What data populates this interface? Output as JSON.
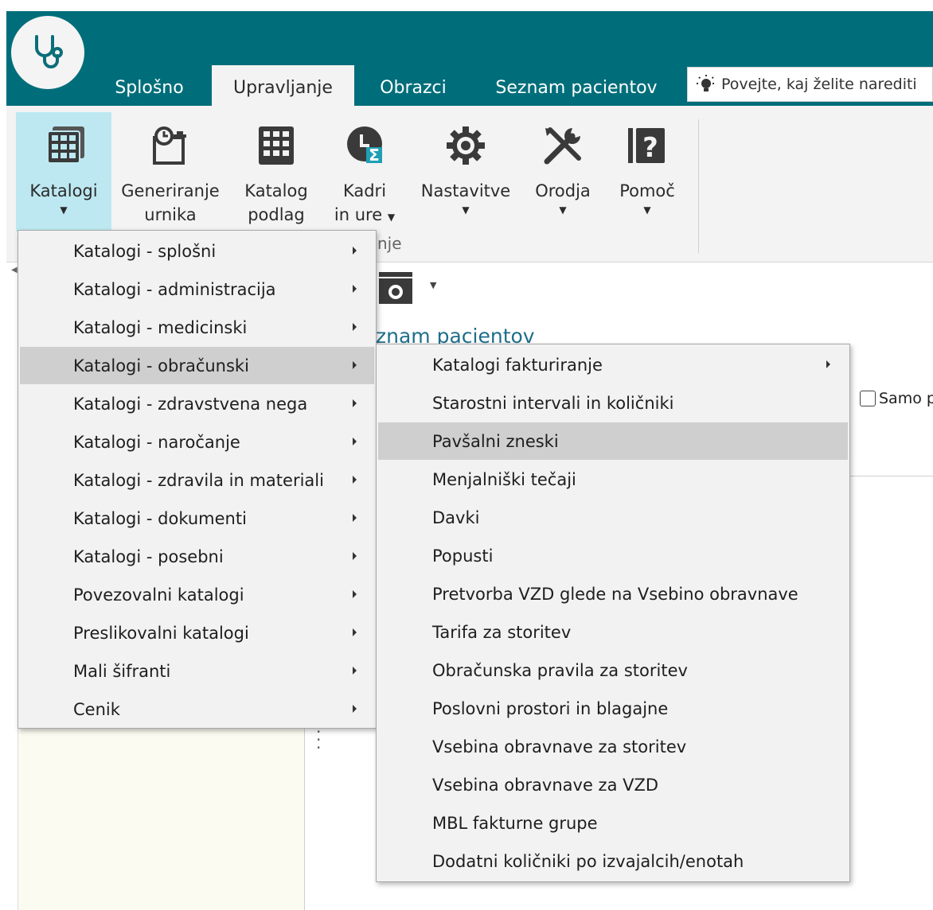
{
  "tabs": [
    {
      "label": "Splošno",
      "active": false
    },
    {
      "label": "Upravljanje",
      "active": true
    },
    {
      "label": "Obrazci",
      "active": false
    },
    {
      "label": "Seznam pacientov",
      "active": false
    }
  ],
  "tell_me": {
    "text": "Povejte, kaj želite narediti"
  },
  "ribbon": {
    "buttons": [
      {
        "line1": "Katalogi",
        "line2": "",
        "icon": "catalog-grid-icon",
        "dropdown": true,
        "active": true
      },
      {
        "line1": "Generiranje",
        "line2": "urnika",
        "icon": "schedule-clock-icon",
        "dropdown": false
      },
      {
        "line1": "Katalog",
        "line2": "podlag",
        "icon": "grid-keypad-icon",
        "dropdown": false
      },
      {
        "line1": "Kadri",
        "line2": "in ure",
        "icon": "staff-sum-icon",
        "dropdown": true
      },
      {
        "line1": "Nastavitve",
        "line2": "",
        "icon": "gear-icon",
        "dropdown": true
      },
      {
        "line1": "Orodja",
        "line2": "",
        "icon": "tools-icon",
        "dropdown": true
      },
      {
        "line1": "Pomoč",
        "line2": "",
        "icon": "help-icon",
        "dropdown": true
      }
    ],
    "group_label": "nje"
  },
  "background": {
    "title": "znam pacientov",
    "checkbox_label": "Samo p"
  },
  "main_menu": {
    "items": [
      {
        "label": "Katalogi - splošni",
        "highlighted": false
      },
      {
        "label": "Katalogi - administracija",
        "highlighted": false
      },
      {
        "label": "Katalogi - medicinski",
        "highlighted": false
      },
      {
        "label": "Katalogi - obračunski",
        "highlighted": true
      },
      {
        "label": "Katalogi - zdravstvena nega",
        "highlighted": false
      },
      {
        "label": "Katalogi - naročanje",
        "highlighted": false
      },
      {
        "label": "Katalogi - zdravila in materiali",
        "highlighted": false
      },
      {
        "label": "Katalogi - dokumenti",
        "highlighted": false
      },
      {
        "label": "Katalogi - posebni",
        "highlighted": false
      },
      {
        "label": "Povezovalni katalogi",
        "highlighted": false
      },
      {
        "label": "Preslikovalni katalogi",
        "highlighted": false
      },
      {
        "label": "Mali šifranti",
        "highlighted": false
      },
      {
        "label": "Cenik",
        "highlighted": false
      }
    ]
  },
  "sub_menu": {
    "items": [
      {
        "label": "Katalogi fakturiranje",
        "highlighted": false,
        "has_sub": true
      },
      {
        "label": "Starostni intervali in količniki",
        "highlighted": false,
        "has_sub": false
      },
      {
        "label": "Pavšalni zneski",
        "highlighted": true,
        "has_sub": false
      },
      {
        "label": "Menjalniški tečaji",
        "highlighted": false,
        "has_sub": false
      },
      {
        "label": "Davki",
        "highlighted": false,
        "has_sub": false
      },
      {
        "label": "Popusti",
        "highlighted": false,
        "has_sub": false
      },
      {
        "label": "Pretvorba VZD glede na Vsebino obravnave",
        "highlighted": false,
        "has_sub": false
      },
      {
        "label": "Tarifa za storitev",
        "highlighted": false,
        "has_sub": false
      },
      {
        "label": "Obračunska pravila za storitev",
        "highlighted": false,
        "has_sub": false
      },
      {
        "label": "Poslovni prostori in blagajne",
        "highlighted": false,
        "has_sub": false
      },
      {
        "label": "Vsebina obravnave za storitev",
        "highlighted": false,
        "has_sub": false
      },
      {
        "label": "Vsebina obravnave za VZD",
        "highlighted": false,
        "has_sub": false
      },
      {
        "label": "MBL fakturne grupe",
        "highlighted": false,
        "has_sub": false
      },
      {
        "label": "Dodatni količniki po izvajalcih/enotah",
        "highlighted": false,
        "has_sub": false
      }
    ]
  },
  "colors": {
    "titlebar": "#006e7a",
    "ribbon": "#f3f3f3",
    "active_button": "#bde8f1",
    "menu_highlight": "#cfcfcf",
    "link_title": "#1e6e8c"
  }
}
